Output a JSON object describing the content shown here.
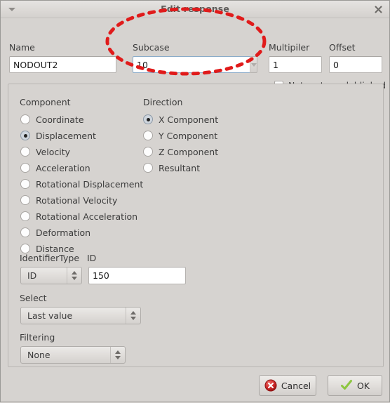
{
  "window": {
    "title": "Edit response",
    "menu_caret": "menu-caret-icon",
    "close_label": "✕"
  },
  "top_form": {
    "name": {
      "label": "Name",
      "value": "NODOUT2"
    },
    "subcase": {
      "label": "Subcase",
      "value": "10"
    },
    "multiplier": {
      "label": "Multipiler",
      "value": "1"
    },
    "offset": {
      "label": "Offset",
      "value": "0"
    },
    "not_metamodel_linked": {
      "label": "Not metamodel-linked",
      "checked": false
    }
  },
  "component_group": {
    "title": "Component",
    "options": [
      {
        "label": "Coordinate",
        "selected": false
      },
      {
        "label": "Displacement",
        "selected": true
      },
      {
        "label": "Velocity",
        "selected": false
      },
      {
        "label": "Acceleration",
        "selected": false
      },
      {
        "label": "Rotational Displacement",
        "selected": false
      },
      {
        "label": "Rotational Velocity",
        "selected": false
      },
      {
        "label": "Rotational Acceleration",
        "selected": false
      },
      {
        "label": "Deformation",
        "selected": false
      },
      {
        "label": "Distance",
        "selected": false
      }
    ]
  },
  "direction_group": {
    "title": "Direction",
    "options": [
      {
        "label": "X Component",
        "selected": true
      },
      {
        "label": "Y Component",
        "selected": false
      },
      {
        "label": "Z Component",
        "selected": false
      },
      {
        "label": "Resultant",
        "selected": false
      }
    ]
  },
  "identifier": {
    "type_label": "IdentifierType",
    "type_value": "ID",
    "id_label": "ID",
    "id_value": "150"
  },
  "select": {
    "label": "Select",
    "value": "Last value"
  },
  "filtering": {
    "label": "Filtering",
    "value": "None"
  },
  "footer": {
    "cancel_label": "Cancel",
    "ok_label": "OK"
  },
  "annotation": {
    "shape": "ellipse",
    "color": "#e01b1b",
    "style": "dashed",
    "target": "Subcase field"
  },
  "colors": {
    "window_bg": "#d6d3d0",
    "titlebar": "#dedbd8",
    "field_bg": "#ffffff",
    "focus_border": "#8aabc9",
    "text": "#3c3c3c",
    "annotation_red": "#e01b1b",
    "cancel_red": "#cc2222",
    "ok_green": "#8cc63f"
  }
}
